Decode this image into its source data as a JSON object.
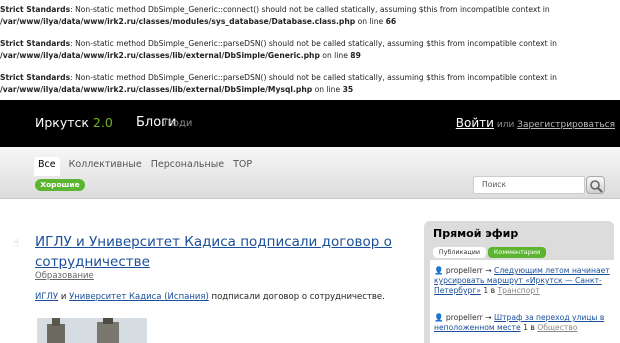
{
  "errors": [
    {
      "label": "Strict Standards",
      "line1": ": Non-static method DbSimple_Generic::connect() should not be called statically, assuming $this from incompatible context in",
      "path": "/var/www/ilya/data/www/irk2.ru/classes/modules/sys_database/Database.class.php",
      "online": " on line ",
      "num": "66"
    },
    {
      "label": "Strict Standards",
      "line1": ": Non-static method DbSimple_Generic::parseDSN() should not be called statically, assuming $this from incompatible context in",
      "path": "/var/www/ilya/data/www/irk2.ru/classes/lib/external/DbSimple/Generic.php",
      "online": " on line ",
      "num": "89"
    },
    {
      "label": "Strict Standards",
      "line1": ": Non-static method DbSimple_Generic::parseDSN() should not be called statically, assuming $this from incompatible context in",
      "path": "/var/www/ilya/data/www/irk2.ru/classes/lib/external/DbSimple/Mysql.php",
      "online": " on line ",
      "num": "35"
    }
  ],
  "header": {
    "city": "Иркутск",
    "version": "2.0",
    "blogs": "Блоги",
    "people": "Люди",
    "login": "Войти",
    "or": "или",
    "register": "Зарегистрироваться"
  },
  "nav": {
    "tabs": [
      "Все",
      "Коллективные",
      "Персональные",
      "TOP"
    ],
    "subtab": "Хорошие",
    "search_placeholder": "Поиск"
  },
  "post": {
    "title": "ИГЛУ и Университет Кадиса подписали договор о сотрудничестве",
    "category": "Образование",
    "desc_link1": "ИГЛУ",
    "desc_and": " и ",
    "desc_link2": "Университет Кадиса (Испания)",
    "desc_rest": " подписали договор о сотрудничестве."
  },
  "sidebar": {
    "title": "Прямой эфир",
    "tabs": [
      "Публикации",
      "Комментарии"
    ],
    "items": [
      {
        "user": "propellerr",
        "link": "Следующим летом начинает курсировать маршрут «Иркутск — Санкт-Петербург»",
        "count": "1",
        "tag": "Транспорт"
      },
      {
        "user": "propellerr",
        "link": "Штраф за переход улицы в неположенном месте",
        "count": "1",
        "tag": "Общество"
      }
    ]
  }
}
